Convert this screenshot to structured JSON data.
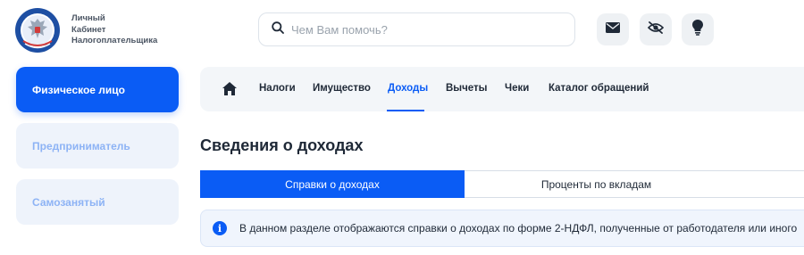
{
  "brand": {
    "lines": [
      "Личный",
      "Кабинет",
      "Налогоплательщика"
    ],
    "emblem": "federal-tax-service-emblem"
  },
  "search": {
    "placeholder": "Чем Вам помочь?",
    "icon": "search-icon"
  },
  "header_icons": [
    {
      "name": "mail-icon"
    },
    {
      "name": "eye-off-icon"
    },
    {
      "name": "lightbulb-icon"
    }
  ],
  "sidebar": {
    "items": [
      {
        "label": "Физическое лицо",
        "active": true
      },
      {
        "label": "Предприниматель",
        "active": false
      },
      {
        "label": "Самозанятый",
        "active": false
      }
    ]
  },
  "nav": {
    "home_icon": "home-icon",
    "items": [
      {
        "label": "Налоги"
      },
      {
        "label": "Имущество"
      },
      {
        "label": "Доходы",
        "active": true
      },
      {
        "label": "Вычеты"
      },
      {
        "label": "Чеки"
      },
      {
        "label": "Каталог обращений"
      }
    ]
  },
  "page": {
    "title": "Сведения о доходах"
  },
  "tabs": [
    {
      "label": "Справки о доходах",
      "active": true
    },
    {
      "label": "Проценты по вкладам",
      "active": false
    }
  ],
  "info": {
    "icon": "info-icon",
    "text": "В данном разделе отображаются справки о доходах по форме 2-НДФЛ, полученные от работодателя или иного"
  },
  "colors": {
    "accent": "#0a5cf5",
    "nav_bg": "#f3f6f9",
    "info_bg": "#f0f5fd"
  }
}
